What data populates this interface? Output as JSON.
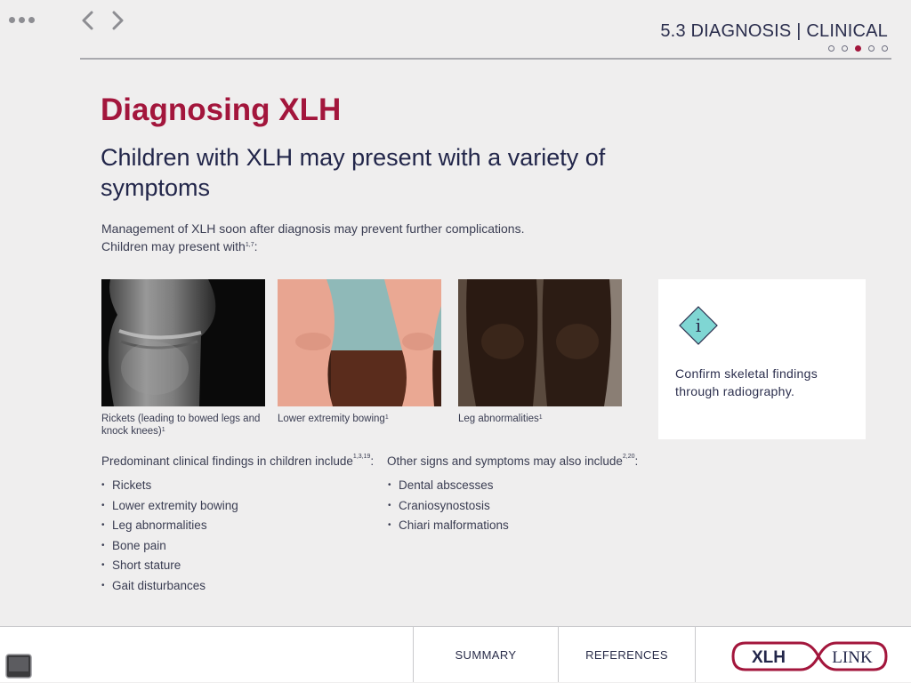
{
  "header": {
    "menu_icon": "more-dots-icon",
    "back_icon": "chevron-left-icon",
    "forward_icon": "chevron-right-icon",
    "section_title": "5.3 DIAGNOSIS | CLINICAL",
    "page_dots": {
      "total": 5,
      "active_index": 3
    }
  },
  "main": {
    "title": "Diagnosing XLH",
    "subtitle": "Children with XLH may present with a variety of symptoms",
    "intro_line1": "Management of XLH soon after diagnosis may prevent further complications.",
    "intro_line2": "Children may present with",
    "intro_line2_ref": "1,7",
    "intro_line2_suffix": ":"
  },
  "images": [
    {
      "caption": "Rickets (leading to bowed legs and knock knees)",
      "ref": "1"
    },
    {
      "caption": "Lower extremity bowing",
      "ref": "1"
    },
    {
      "caption": "Leg abnormalities",
      "ref": "1"
    }
  ],
  "info_card": {
    "icon": "info-diamond-icon",
    "text": "Confirm skeletal findings through radiography."
  },
  "lists": {
    "left": {
      "title": "Predominant clinical findings in children include",
      "ref": "1,3,19",
      "suffix": ":",
      "items": [
        "Rickets",
        "Lower extremity bowing",
        "Leg abnormalities",
        "Bone pain",
        "Short stature",
        "Gait disturbances"
      ]
    },
    "right": {
      "title": "Other signs and symptoms may also include",
      "ref": "2,20",
      "suffix": ":",
      "items": [
        "Dental abscesses",
        "Craniosynostosis",
        "Chiari malformations"
      ]
    }
  },
  "footer": {
    "summary_label": "SUMMARY",
    "references_label": "REFERENCES",
    "logo_left": "XLH",
    "logo_right": "LINK"
  },
  "colors": {
    "accent": "#a3163c",
    "navy": "#2b2e4d",
    "info_teal": "#7fd6d3"
  }
}
